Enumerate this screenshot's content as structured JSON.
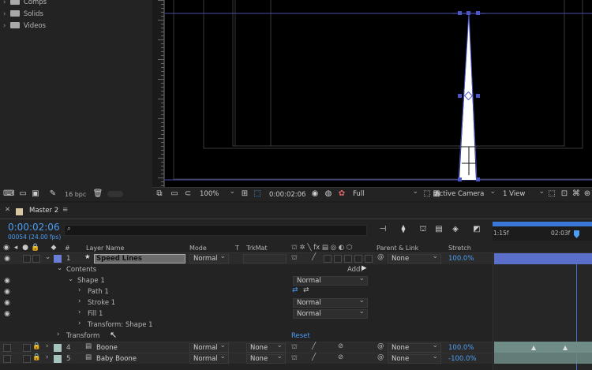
{
  "project": {
    "items": [
      {
        "label": "Comps"
      },
      {
        "label": "Solids"
      },
      {
        "label": "Videos"
      }
    ],
    "bpc": "16 bpc"
  },
  "viewer": {
    "zoom": "100%",
    "timecode": "0:00:02:06",
    "resolution": "Full",
    "camera": "Active Camera",
    "views": "1 View"
  },
  "timeline": {
    "tab_name": "Master 2",
    "current_time": "0:00:02:06",
    "frame_info": "00054 (24.00 fps)",
    "search_placeholder": "",
    "ruler": {
      "start": "1:15f",
      "mark": "02:03f"
    },
    "headers": {
      "num": "#",
      "layer_name": "Layer Name",
      "mode": "Mode",
      "t": "T",
      "trkmat": "TrkMat",
      "parent": "Parent & Link",
      "stretch": "Stretch"
    },
    "layers": [
      {
        "num": "1",
        "name": "Speed Lines",
        "mode": "Normal",
        "parent": "None",
        "stretch": "100.0%",
        "color": "#6a7fd6"
      },
      {
        "num": "4",
        "name": "Boone",
        "mode": "Normal",
        "trkmat": "None",
        "parent": "None",
        "stretch": "100.0%",
        "color": "#a6c4bd"
      },
      {
        "num": "5",
        "name": "Baby Boone",
        "mode": "Normal",
        "trkmat": "None",
        "parent": "None",
        "stretch": "-100.0%",
        "color": "#a6c4bd"
      }
    ],
    "contents": {
      "label": "Contents",
      "add_label": "Add:",
      "shape": "Shape 1",
      "shape_mode": "Normal",
      "path": "Path 1",
      "stroke": "Stroke 1",
      "stroke_mode": "Normal",
      "fill": "Fill 1",
      "fill_mode": "Normal",
      "transform_shape": "Transform: Shape 1"
    },
    "transform": {
      "label": "Transform",
      "reset": "Reset"
    }
  },
  "colors": {
    "accent": "#4b9ef4",
    "layer_bar": "#5a6fc9",
    "track_bar": "#6f8c86"
  }
}
